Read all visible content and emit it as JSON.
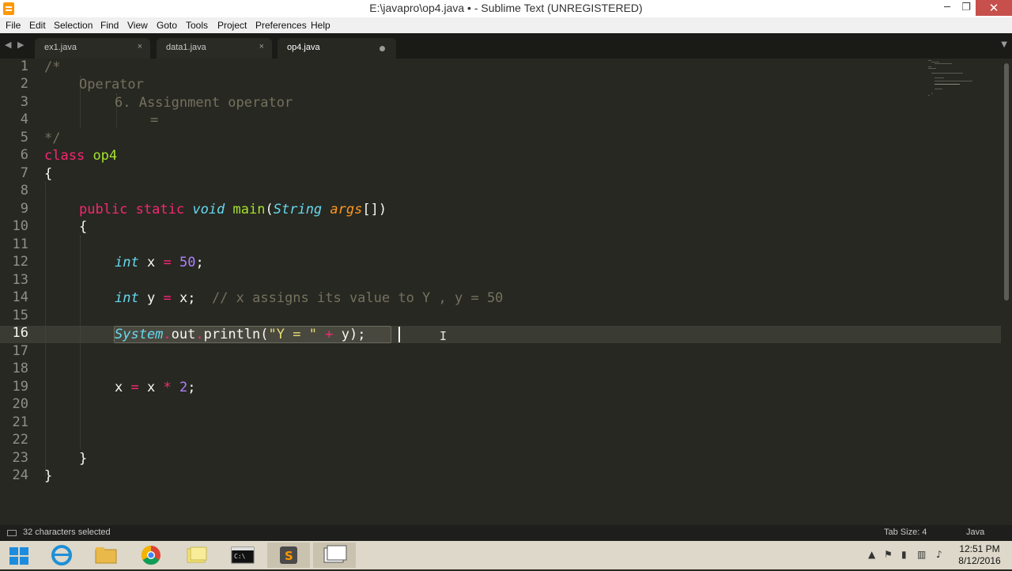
{
  "window": {
    "title": "E:\\javapro\\op4.java • - Sublime Text (UNREGISTERED)",
    "min_label": "─",
    "max_label": "❐",
    "close_label": "✕"
  },
  "menu": {
    "items": [
      "File",
      "Edit",
      "Selection",
      "Find",
      "View",
      "Goto",
      "Tools",
      "Project",
      "Preferences",
      "Help"
    ]
  },
  "tabs": {
    "items": [
      {
        "label": "ex1.java",
        "close": "×"
      },
      {
        "label": "data1.java",
        "close": "×"
      },
      {
        "label": "op4.java",
        "modified": true
      }
    ],
    "active": "op4.java",
    "nav_left": "◀",
    "nav_right": "▶",
    "dropdown": "▼"
  },
  "editor": {
    "language": "Java",
    "current_line": 16,
    "line_numbers": [
      "1",
      "2",
      "3",
      "4",
      "5",
      "6",
      "7",
      "8",
      "9",
      "10",
      "11",
      "12",
      "13",
      "14",
      "15",
      "16",
      "17",
      "18",
      "19",
      "20",
      "21",
      "22",
      "23",
      "24"
    ],
    "lines": [
      "/*",
      "    Operator",
      "        6. Assignment operator",
      "            =",
      "*/",
      "class op4",
      "{",
      "",
      "    public static void main(String args[])",
      "    {",
      "",
      "        int x = 50;",
      "",
      "        int y = x;  // x assigns its value to Y , y = 50",
      "",
      "        System.out.println(\"Y = \" + y);",
      "",
      "",
      "        x = x * 2;",
      "",
      "",
      "",
      "    }",
      "}"
    ],
    "tokens": {
      "comment_open": "/*",
      "comment_l2": "Operator",
      "comment_l3": "6. Assignment operator",
      "comment_l4": "=",
      "comment_close": "*/",
      "kw_class": "class",
      "class_name": "op4",
      "brace_open": "{",
      "brace_close": "}",
      "kw_public": "public",
      "kw_static": "static",
      "kw_void": "void",
      "fn_main": "main",
      "paren_open": "(",
      "type_string": "String",
      "param_args": "args",
      "param_tail": "[])",
      "kw_int": "int",
      "var_x": "x",
      "var_y": "y",
      "op_assign": "=",
      "num_50": "50",
      "semicolon": ";",
      "line14_comment": "// x assigns its value to Y , y = 50",
      "sys_class": "System",
      "dot": ".",
      "out": "out",
      "println": "println",
      "str_y": "\"Y = \"",
      "op_plus": "+",
      "line16_tail": "y);",
      "op_mul": "*",
      "num_2": "2"
    }
  },
  "status": {
    "selection": "32 characters selected",
    "tab_size": "Tab Size: 4",
    "syntax": "Java"
  },
  "taskbar": {
    "clock_time": "12:51 PM",
    "clock_date": "8/12/2016",
    "tray_up_arrow": "▲"
  },
  "colors": {
    "editor_bg": "#272822",
    "comment": "#75715e",
    "keyword": "#f92672",
    "type": "#66d9ef",
    "function": "#a6e22e",
    "param": "#fd971f",
    "number": "#ae81ff",
    "string": "#e6db74"
  }
}
